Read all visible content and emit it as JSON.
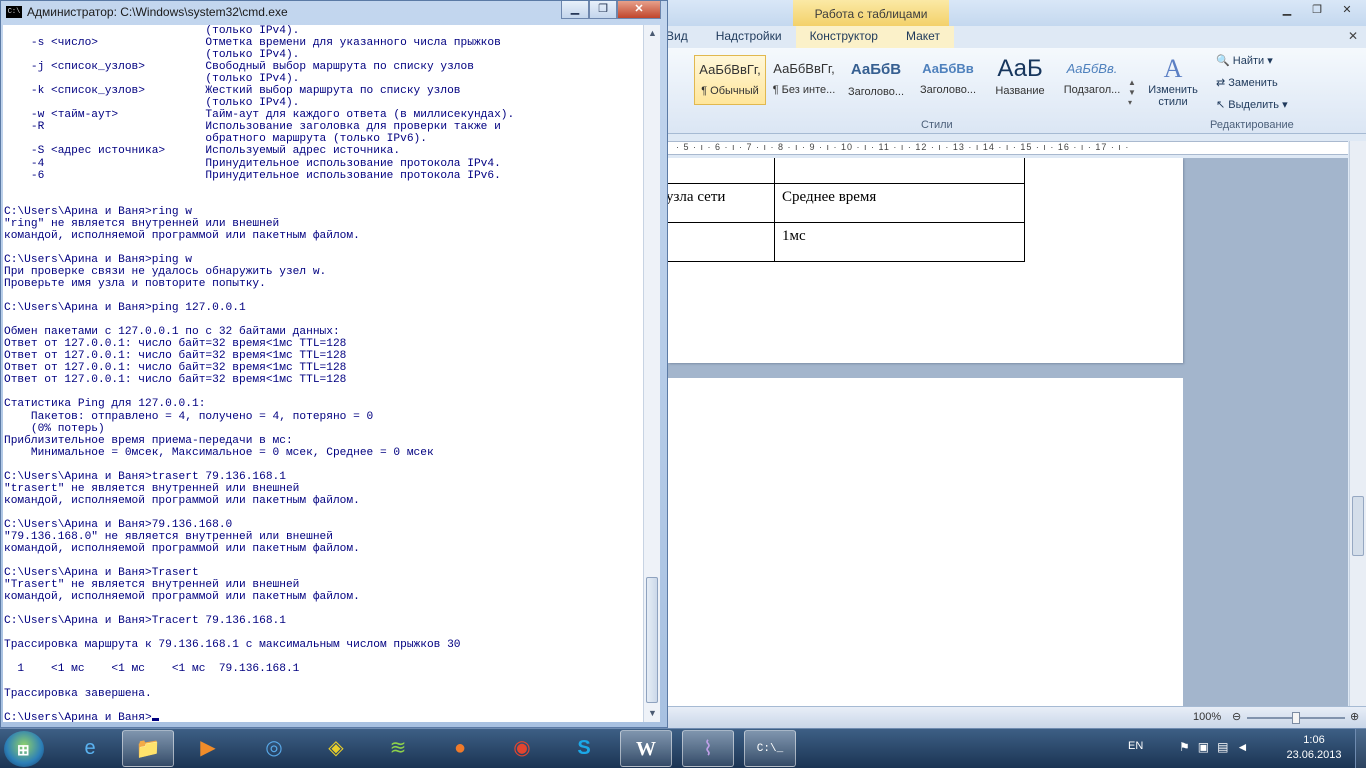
{
  "word": {
    "context_tab_group": "Работа с таблицами",
    "tabs": [
      "Вид",
      "Надстройки",
      "Конструктор",
      "Макет"
    ],
    "styles": [
      {
        "sample": "АаБбВвГг,",
        "name": "¶ Обычный"
      },
      {
        "sample": "АаБбВвГг,",
        "name": "¶ Без инте..."
      },
      {
        "sample": "АаБбВ",
        "name": "Заголово..."
      },
      {
        "sample": "АаБбВв",
        "name": "Заголово..."
      },
      {
        "sample": "АаБ",
        "name": "Название"
      },
      {
        "sample": "АаБбВв.",
        "name": "Подзагол..."
      }
    ],
    "change_styles": "Изменить стили",
    "styles_group": "Стили",
    "edit_group": "Редактирование",
    "edit_find": "Найти",
    "edit_replace": "Заменить",
    "edit_select": "Выделить",
    "ruler": "· 5 · ı · 6 · ı · 7 · ı · 8 · ı · 9 · ı · 10 · ı · 11 · ı · 12 · ı · 13 · ı 14 · ı · 15 · ı · 16 · ı · 17 · ı ·",
    "table": [
      [
        "узла сети",
        "Среднее время"
      ],
      [
        "",
        "1мс"
      ]
    ],
    "zoom": "100%"
  },
  "cmd": {
    "title": "Администратор: C:\\Windows\\system32\\cmd.exe",
    "console": "                              (только IPv4).\n    -s <число>                Отметка времени для указанного числа прыжков\n                              (только IPv4).\n    -j <список_узлов>         Свободный выбор маршрута по списку узлов\n                              (только IPv4).\n    -k <список_узлов>         Жесткий выбор маршрута по списку узлов\n                              (только IPv4).\n    -w <тайм-аут>             Тайм-аут для каждого ответа (в миллисекундах).\n    -R                        Использование заголовка для проверки также и\n                              обратного маршрута (только IPv6).\n    -S <адрес источника>      Используемый адрес источника.\n    -4                        Принудительное использование протокола IPv4.\n    -6                        Принудительное использование протокола IPv6.\n\n\nC:\\Users\\Арина и Ваня>ring w\n\"ring\" не является внутренней или внешней\nкомандой, исполняемой программой или пакетным файлом.\n\nC:\\Users\\Арина и Ваня>ping w\nПри проверке связи не удалось обнаружить узел w.\nПроверьте имя узла и повторите попытку.\n\nC:\\Users\\Арина и Ваня>ping 127.0.0.1\n\nОбмен пакетами с 127.0.0.1 по с 32 байтами данных:\nОтвет от 127.0.0.1: число байт=32 время<1мс TTL=128\nОтвет от 127.0.0.1: число байт=32 время<1мс TTL=128\nОтвет от 127.0.0.1: число байт=32 время<1мс TTL=128\nОтвет от 127.0.0.1: число байт=32 время<1мс TTL=128\n\nСтатистика Ping для 127.0.0.1:\n    Пакетов: отправлено = 4, получено = 4, потеряно = 0\n    (0% потерь)\nПриблизительное время приема-передачи в мс:\n    Минимальное = 0мсек, Максимальное = 0 мсек, Среднее = 0 мсек\n\nC:\\Users\\Арина и Ваня>trasert 79.136.168.1\n\"trasert\" не является внутренней или внешней\nкомандой, исполняемой программой или пакетным файлом.\n\nC:\\Users\\Арина и Ваня>79.136.168.0\n\"79.136.168.0\" не является внутренней или внешней\nкомандой, исполняемой программой или пакетным файлом.\n\nC:\\Users\\Арина и Ваня>Trasert\n\"Trasert\" не является внутренней или внешней\nкомандой, исполняемой программой или пакетным файлом.\n\nC:\\Users\\Арина и Ваня>Tracert 79.136.168.1\n\nТрассировка маршрута к 79.136.168.1 с максимальным числом прыжков 30\n\n  1    <1 мс    <1 мс    <1 мс  79.136.168.1\n\nТрассировка завершена.\n\n",
    "prompt": "C:\\Users\\Арина и Ваня>"
  },
  "taskbar": {
    "lang": "EN",
    "time": "1:06",
    "date": "23.06.2013",
    "items": [
      "ie-icon",
      "explorer-icon",
      "media-player-icon",
      "network-icon",
      "chrome-canary-icon",
      "wifi-icon",
      "firefox-icon",
      "chrome-icon",
      "skype-icon",
      "word-icon",
      "onenote-icon",
      "cmd-icon"
    ]
  },
  "colors": {
    "console_text": "#000080",
    "taskbar": "#1b3453",
    "context_tab": "#f3d16a"
  }
}
